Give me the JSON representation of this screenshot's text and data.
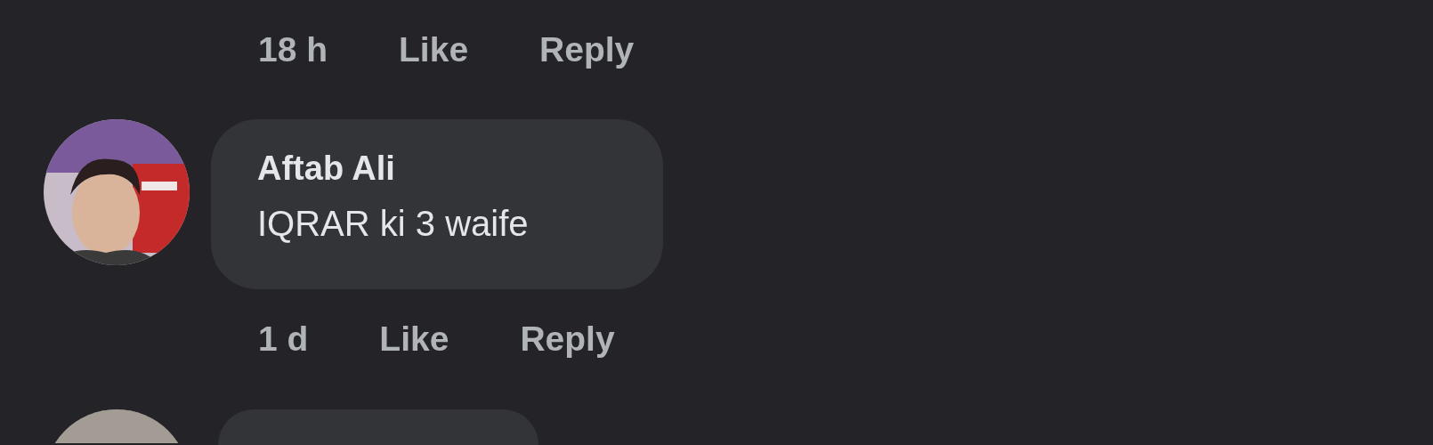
{
  "top_actions": {
    "time": "18 h",
    "like": "Like",
    "reply": "Reply"
  },
  "comments": [
    {
      "author": "Aftab Ali",
      "text": "IQRAR ki 3 waife",
      "time": "1 d",
      "like": "Like",
      "reply": "Reply"
    }
  ]
}
